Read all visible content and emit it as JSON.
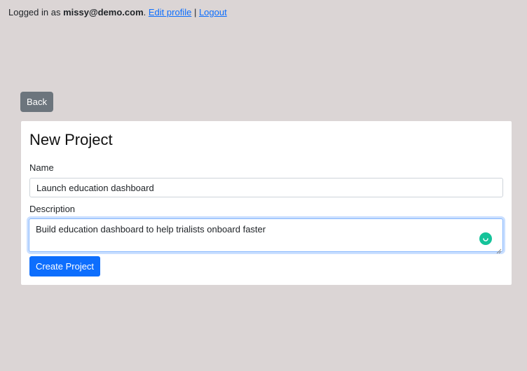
{
  "header": {
    "logged_in_prefix": "Logged in as",
    "user_email": "missy@demo.com",
    "separator_dot": ".",
    "edit_profile_link": "Edit profile",
    "pipe": "|",
    "logout_link": "Logout"
  },
  "back_button": {
    "label": "Back"
  },
  "form": {
    "title": "New Project",
    "name_label": "Name",
    "name_value": "Launch education dashboard",
    "description_label": "Description",
    "description_value": "Build education dashboard to help trialists onboard faster",
    "submit_label": "Create Project"
  },
  "colors": {
    "page_background": "#dbd5d5",
    "primary": "#0d6efd",
    "secondary": "#6c757d",
    "grammar_icon": "#15c39a"
  }
}
